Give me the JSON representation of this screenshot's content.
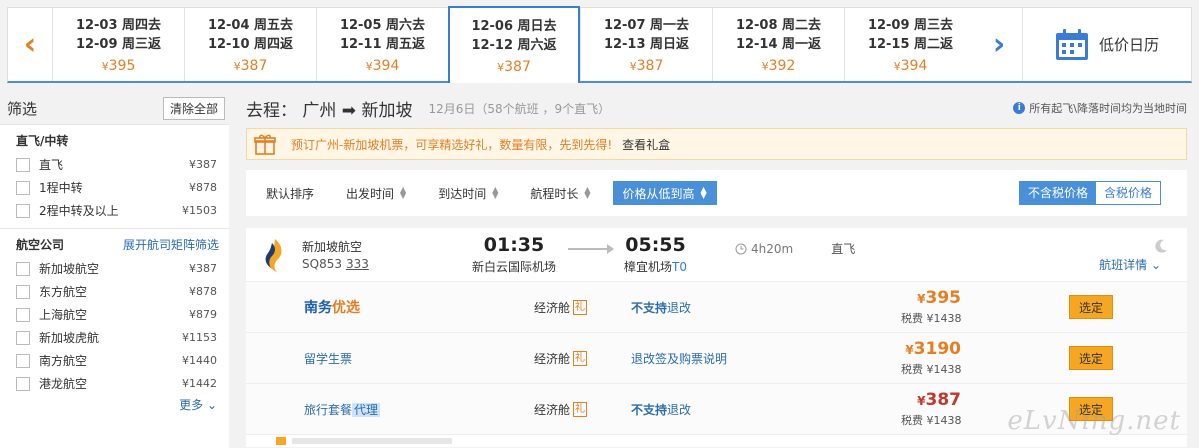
{
  "date_strip": {
    "cells": [
      {
        "go": "12-03 周四去",
        "back": "12-09 周三返",
        "price": "395"
      },
      {
        "go": "12-04 周五去",
        "back": "12-10 周四返",
        "price": "387"
      },
      {
        "go": "12-05 周六去",
        "back": "12-11 周五返",
        "price": "394"
      },
      {
        "go": "12-06 周日去",
        "back": "12-12 周六返",
        "price": "387"
      },
      {
        "go": "12-07 周一去",
        "back": "12-13 周日返",
        "price": "387"
      },
      {
        "go": "12-08 周二去",
        "back": "12-14 周一返",
        "price": "392"
      },
      {
        "go": "12-09 周三去",
        "back": "12-15 周二返",
        "price": "394"
      }
    ],
    "currency": "¥",
    "calendar_label": "低价日历",
    "accent": "#3a7bd5",
    "price_color": "#e67e22"
  },
  "filter": {
    "title": "筛选",
    "clear_label": "清除全部",
    "stops": {
      "title": "直飞/中转",
      "items": [
        {
          "name": "直飞",
          "price": "¥387"
        },
        {
          "name": "1程中转",
          "price": "¥878"
        },
        {
          "name": "2程中转及以上",
          "price": "¥1503"
        }
      ]
    },
    "airlines": {
      "title": "航空公司",
      "matrix_link": "展开航司矩阵筛选",
      "items": [
        {
          "name": "新加坡航空",
          "price": "¥387"
        },
        {
          "name": "东方航空",
          "price": "¥878"
        },
        {
          "name": "上海航空",
          "price": "¥879"
        },
        {
          "name": "新加坡虎航",
          "price": "¥1153"
        },
        {
          "name": "南方航空",
          "price": "¥1440"
        },
        {
          "name": "港龙航空",
          "price": "¥1442"
        }
      ],
      "more_label": "更多"
    }
  },
  "route": {
    "title": "去程： 广州 ➡ 新加坡",
    "subtitle": "12月6日（58个航班 ，9个直飞）",
    "note": "所有起飞\\降落时间均为当地时间"
  },
  "promo": {
    "text": "预订广州-新加坡机票，可享精选好礼，数量有限，先到先得!",
    "link": "查看礼盒"
  },
  "sortbar": {
    "items": [
      "默认排序",
      "出发时间",
      "到达时间",
      "航程时长",
      "价格从低到高"
    ],
    "tax_on": "不含税价格",
    "tax_off": "含税价格"
  },
  "flight": {
    "airline": "新加坡航空",
    "flight_no": "SQ853",
    "aircraft": "333",
    "dep_time": "01:35",
    "dep_airport": "新白云国际机场",
    "arr_time": "05:55",
    "arr_airport": "樟宜机场",
    "arr_terminal": "T0",
    "duration": "4h20m",
    "direct": "直飞",
    "detail_label": "航班详情",
    "fares": [
      {
        "name_a": "南务",
        "name_b": "优选",
        "cabin": "经济舱",
        "gift": "礼",
        "rule_a": "不支持",
        "rule_b": "退改",
        "price": "395",
        "tax": "税费 ¥1438",
        "book": "选定"
      },
      {
        "name": "留学生票",
        "cabin": "经济舱",
        "gift": "礼",
        "rule": "退改签及购票说明",
        "price": "3190",
        "tax": "税费 ¥1438",
        "book": "选定"
      },
      {
        "name": "旅行套餐",
        "agent": "代理",
        "cabin": "经济舱",
        "gift": "礼",
        "rule_a": "不支持",
        "rule_b": "退改",
        "price": "387",
        "tax": "税费 ¥1438",
        "book": "选定"
      }
    ]
  },
  "watermark": "eLvNing.net"
}
